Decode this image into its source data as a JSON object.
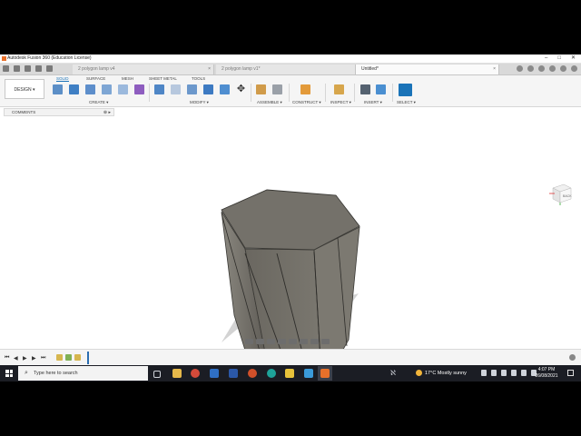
{
  "window": {
    "title": "Autodesk Fusion 360 (Education License)",
    "controls": [
      "–",
      "□",
      "✕"
    ]
  },
  "doc_tabs": [
    {
      "label": "2 polygon lamp v4",
      "active": false
    },
    {
      "label": "2 polygon lamp v1*",
      "active": false
    },
    {
      "label": "Untitled*",
      "active": true
    }
  ],
  "ribbon": {
    "workspace": "DESIGN ▾",
    "tabs": [
      "SOLID",
      "SURFACE",
      "MESH",
      "SHEET METAL",
      "TOOLS"
    ],
    "groups": [
      "CREATE ▾",
      "MODIFY ▾",
      "ASSEMBLE ▾",
      "CONSTRUCT ▾",
      "INSPECT ▾",
      "INSERT ▾",
      "SELECT ▾"
    ]
  },
  "browser": {
    "label": "COMMENTS",
    "control": "⊕ ▸"
  },
  "viewcube": {
    "face_label": "BACK"
  },
  "timeline": {
    "controls": [
      "⏮",
      "◀",
      "▶",
      "▶",
      "⏭"
    ]
  },
  "taskbar": {
    "search_placeholder": "Type here to search",
    "weather": "17°C  Mostly sunny",
    "time": "4:07 PM",
    "date": "26/08/2021"
  },
  "colors": {
    "accent": "#1a73b8",
    "body_fill": "#6e6b64",
    "shadow": "#d2d2d2",
    "taskbar": "#1b1d24"
  }
}
